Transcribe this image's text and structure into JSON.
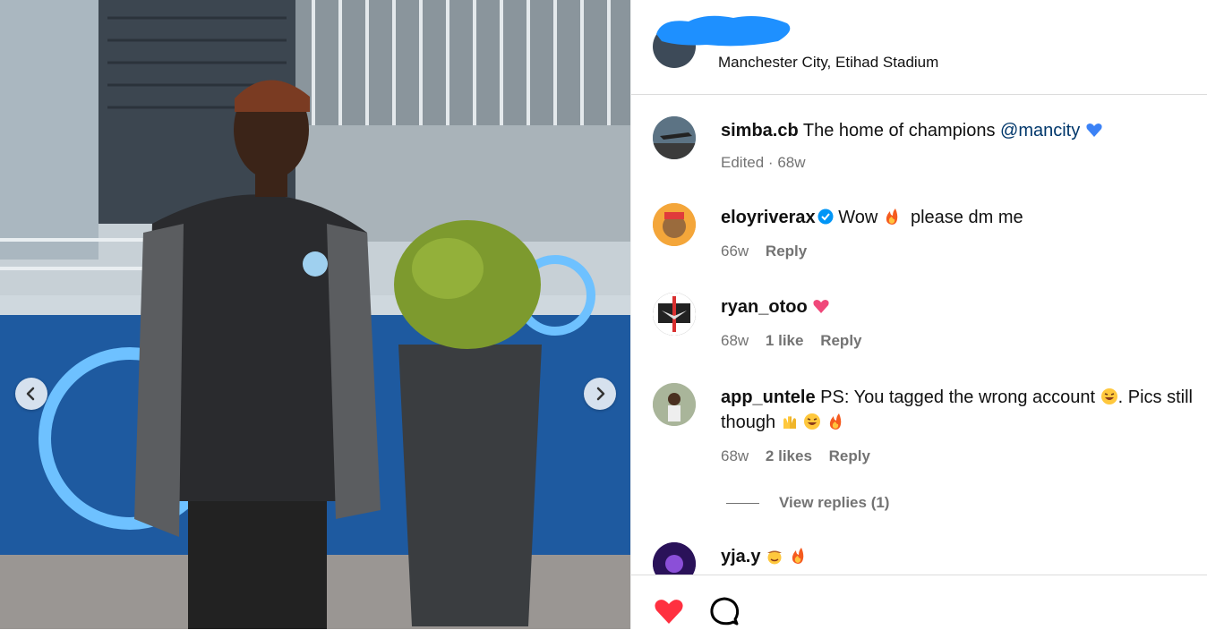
{
  "post": {
    "location": "Manchester City, Etihad Stadium",
    "photo_nav": {
      "prev_icon": "chevron-left-icon",
      "next_icon": "chevron-right-icon"
    }
  },
  "comments": [
    {
      "username": "simba.cb",
      "text": "The home of champions",
      "mention": "@mancity",
      "emoji": "blue-heart",
      "edited": "Edited",
      "sep": " · ",
      "time": "68w"
    },
    {
      "username": "eloyriverax",
      "verified": true,
      "text_a": "Wow",
      "text_b": "please dm me",
      "time": "66w",
      "reply": "Reply"
    },
    {
      "username": "ryan_otoo",
      "time": "68w",
      "likes": "1 like",
      "reply": "Reply"
    },
    {
      "username": "app_untele",
      "line1": "PS: You tagged the wrong account",
      "line1_tail": ". Pics still",
      "line2": "though",
      "time": "68w",
      "likes": "2 likes",
      "reply": "Reply"
    },
    {
      "username": "yja.y"
    }
  ],
  "view_replies": "View replies (1)",
  "actions": {
    "like_icon": "heart-icon",
    "comment_icon": "comment-icon"
  },
  "colors": {
    "like_red": "#ff3040",
    "mention_blue": "#00376b",
    "meta_gray": "#737373",
    "redaction_blue": "#1e90ff"
  }
}
